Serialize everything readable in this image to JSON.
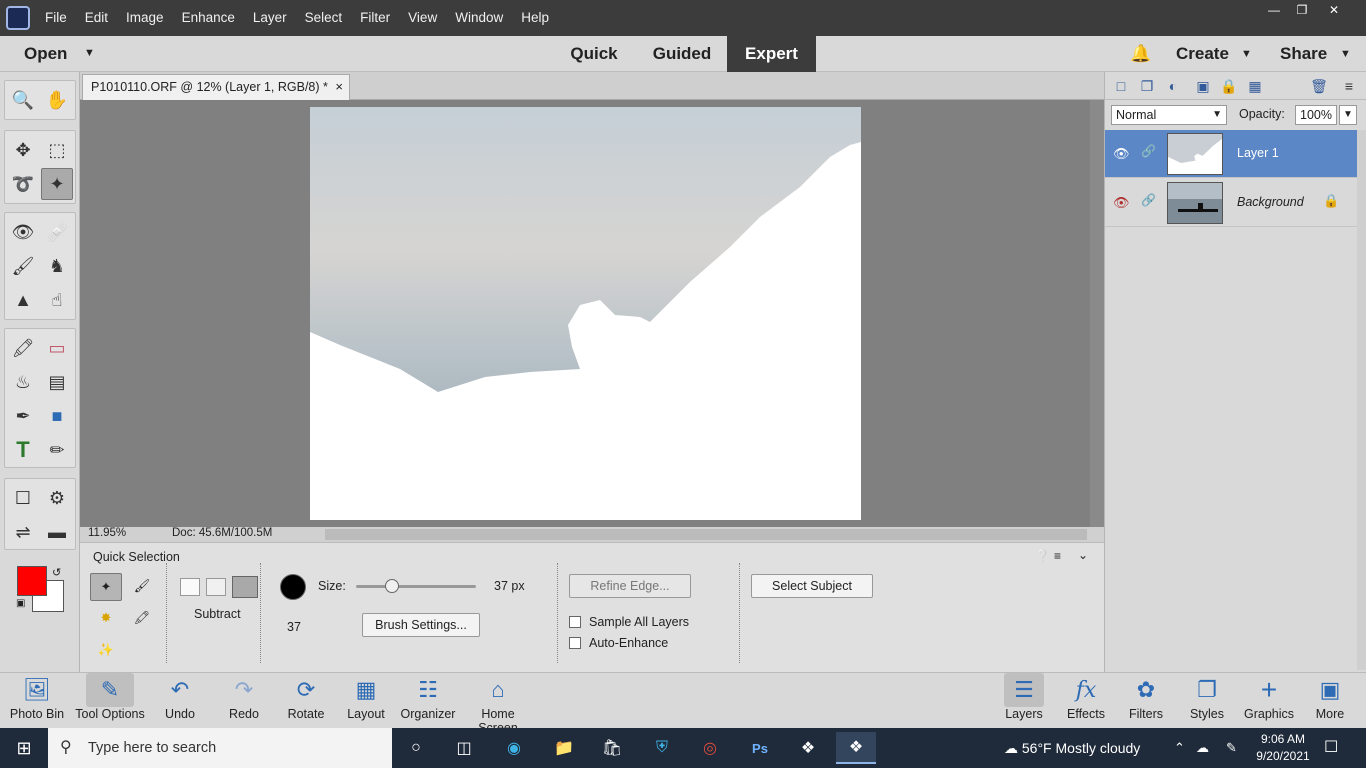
{
  "menubar": {
    "items": [
      "File",
      "Edit",
      "Image",
      "Enhance",
      "Layer",
      "Select",
      "Filter",
      "View",
      "Window",
      "Help"
    ]
  },
  "modebar": {
    "open_label": "Open",
    "tabs": [
      "Quick",
      "Guided",
      "Expert"
    ],
    "active_tab": "Expert",
    "create_label": "Create",
    "share_label": "Share"
  },
  "document": {
    "tab_title": "P1010110.ORF @ 12% (Layer 1, RGB/8) *",
    "close_glyph": "×"
  },
  "statusbar": {
    "zoom": "11.95%",
    "doc_size": "Doc: 45.6M/100.5M"
  },
  "tool_options": {
    "title": "Quick Selection",
    "mode_label": "Subtract",
    "brush_size_value": "37",
    "size_label": "Size:",
    "size_px": "37 px",
    "size_fraction": 0.3,
    "brush_settings_label": "Brush Settings...",
    "refine_edge_label": "Refine Edge...",
    "sample_all_layers_label": "Sample All Layers",
    "auto_enhance_label": "Auto-Enhance",
    "select_subject_label": "Select Subject"
  },
  "layers_panel": {
    "blend_mode": "Normal",
    "opacity_label": "Opacity:",
    "opacity_value": "100%",
    "layers": [
      {
        "name": "Layer 1",
        "selected": true,
        "visible": true
      },
      {
        "name": "Background",
        "selected": false,
        "visible": false
      }
    ]
  },
  "bottombar": {
    "left_items": [
      "Photo Bin",
      "Tool Options",
      "Undo",
      "Redo",
      "Rotate",
      "Layout",
      "Organizer",
      "Home Screen"
    ],
    "right_items": [
      "Layers",
      "Effects",
      "Filters",
      "Styles",
      "Graphics",
      "More"
    ]
  },
  "taskbar": {
    "search_placeholder": "Type here to search",
    "weather": "56°F  Mostly cloudy",
    "time": "9:06 AM",
    "date": "9/20/2021"
  },
  "colors": {
    "foreground": "#ff0000",
    "background": "#ffffff",
    "accent": "#5b87c6"
  }
}
